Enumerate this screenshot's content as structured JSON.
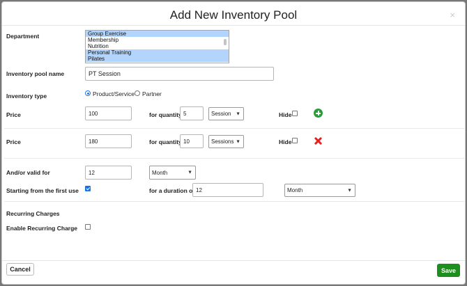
{
  "modal": {
    "title": "Add New Inventory Pool",
    "close": "×"
  },
  "department": {
    "label": "Department",
    "options": [
      {
        "label": "Group Exercise",
        "selected": true
      },
      {
        "label": "Membership",
        "selected": false
      },
      {
        "label": "Nutrition",
        "selected": false
      },
      {
        "label": "Personal Training",
        "selected": true
      },
      {
        "label": "Pilates",
        "selected": true
      }
    ]
  },
  "pool_name": {
    "label": "Inventory pool name",
    "value": "PT Session"
  },
  "inventory_type": {
    "label": "Inventory type",
    "options": [
      {
        "label": "Product/Service",
        "checked": true
      },
      {
        "label": "Partner",
        "checked": false
      }
    ]
  },
  "price_rows": [
    {
      "label": "Price",
      "price": "100",
      "qty_label": "for quantity",
      "qty": "5",
      "unit": "Session",
      "hide_label": "Hide",
      "hide": false,
      "action_icon": "add-circle-icon"
    },
    {
      "label": "Price",
      "price": "180",
      "qty_label": "for quantity",
      "qty": "10",
      "unit": "Sessions",
      "hide_label": "Hide",
      "hide": false,
      "action_icon": "remove-x-icon"
    }
  ],
  "validity": {
    "label": "And/or valid for",
    "value": "12",
    "unit": "Month"
  },
  "first_use": {
    "label": "Starting from the first use",
    "checked": true,
    "duration_label": "for a duration of",
    "duration_value": "12",
    "duration_unit": "Month"
  },
  "recurring": {
    "section_label": "Recurring Charges",
    "enable_label": "Enable Recurring Charge",
    "enabled": false
  },
  "footer": {
    "cancel_label": "Cancel",
    "save_label": "Save"
  },
  "colors": {
    "save": "#1e8e1e",
    "add_icon": "#2e9a3e",
    "remove_icon": "#e02424",
    "selected_option": "#b3d4fc"
  }
}
